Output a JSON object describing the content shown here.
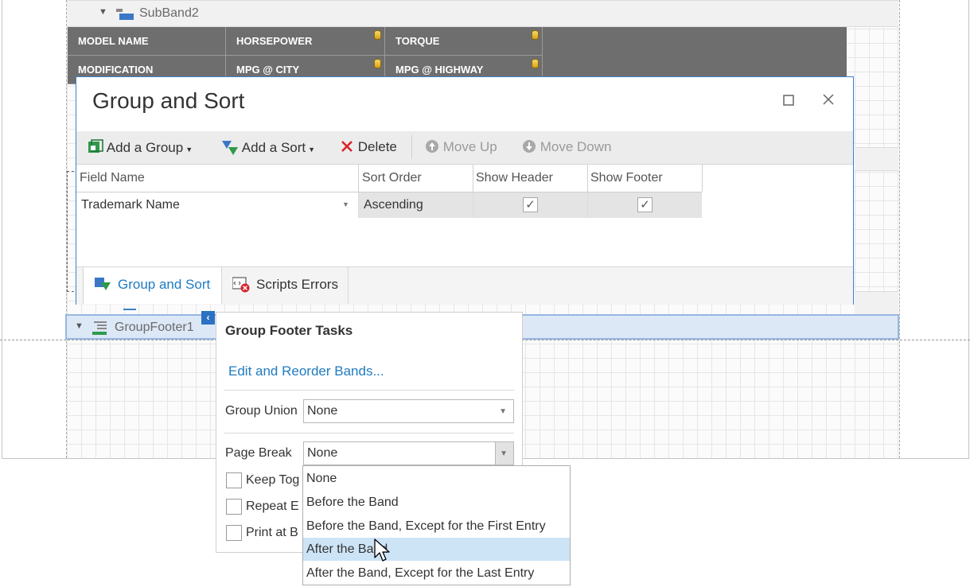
{
  "designer": {
    "subband_title": "SubBand2",
    "table": {
      "row1": [
        "MODEL NAME",
        "HORSEPOWER",
        "TORQUE"
      ],
      "row2": [
        "MODIFICATION",
        "MPG @ CITY",
        "MPG @ HIGHWAY"
      ]
    },
    "group_footer_title": "GroupFooter1"
  },
  "group_sort_dialog": {
    "title": "Group and Sort",
    "toolbar": {
      "add_group": "Add a Group",
      "add_sort": "Add a Sort",
      "delete": "Delete",
      "move_up": "Move Up",
      "move_down": "Move Down"
    },
    "columns": [
      "Field Name",
      "Sort Order",
      "Show Header",
      "Show Footer"
    ],
    "rows": [
      {
        "field_name": "Trademark Name",
        "sort_order": "Ascending",
        "show_header": true,
        "show_footer": true
      }
    ],
    "tabs": [
      "Group and Sort",
      "Scripts Errors"
    ]
  },
  "group_footer_tasks": {
    "title": "Group Footer Tasks",
    "link": "Edit and Reorder Bands...",
    "group_union_label": "Group Union",
    "group_union_value": "None",
    "page_break_label": "Page Break",
    "page_break_value": "None",
    "checkboxes": [
      "Keep Tog",
      "Repeat E",
      "Print at B"
    ]
  },
  "page_break_dropdown": {
    "options": [
      "None",
      "Before the Band",
      "Before the Band, Except for the First Entry",
      "After the Band",
      "After the Band, Except for the Last Entry"
    ],
    "highlighted_index": 3
  },
  "colors": {
    "accent": "#2b72c2",
    "link": "#1f7bc1",
    "table_header_bg": "#6e6e6e",
    "selection": "#cde4f7"
  }
}
